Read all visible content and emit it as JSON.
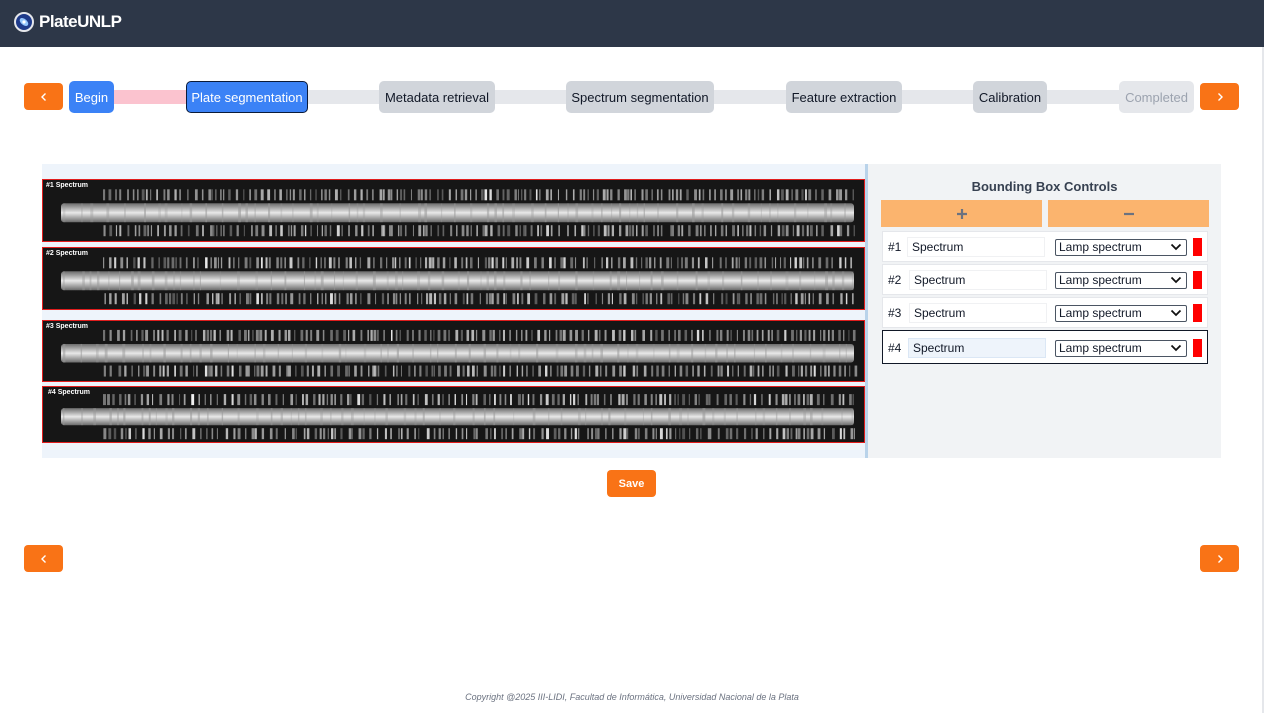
{
  "app": {
    "title": "PlateUNLP",
    "logo_icon": "plate-logo-icon"
  },
  "stepper": {
    "prev_icon": "chevron-left-icon",
    "next_icon": "chevron-right-icon",
    "steps": [
      {
        "label": "Begin",
        "state": "done"
      },
      {
        "label": "Plate segmentation",
        "state": "active"
      },
      {
        "label": "Metadata retrieval",
        "state": "pending"
      },
      {
        "label": "Spectrum segmentation",
        "state": "pending"
      },
      {
        "label": "Feature extraction",
        "state": "pending"
      },
      {
        "label": "Calibration",
        "state": "pending"
      },
      {
        "label": "Completed",
        "state": "disabled"
      }
    ]
  },
  "viewer": {
    "spectra": [
      {
        "label": "#1 Spectrum"
      },
      {
        "label": "#2 Spectrum"
      },
      {
        "label": "#3 Spectrum"
      },
      {
        "label": "#4 Spectrum"
      }
    ],
    "box_color": "#e11d1d"
  },
  "controls": {
    "title": "Bounding Box Controls",
    "add_icon": "plus-icon",
    "remove_icon": "minus-icon",
    "rows": [
      {
        "num": "#1",
        "name": "Spectrum",
        "type": "Lamp spectrum",
        "color": "#ff0000"
      },
      {
        "num": "#2",
        "name": "Spectrum",
        "type": "Lamp spectrum",
        "color": "#ff0000"
      },
      {
        "num": "#3",
        "name": "Spectrum",
        "type": "Lamp spectrum",
        "color": "#ff0000"
      },
      {
        "num": "#4",
        "name": "Spectrum",
        "type": "Lamp spectrum",
        "color": "#ff0000",
        "selected": true
      }
    ]
  },
  "actions": {
    "save_label": "Save"
  },
  "footer": {
    "text": "Copyright @2025 III-LIDI, Facultad de Informática, Universidad Nacional de la Plata"
  },
  "colors": {
    "accent": "#f97316",
    "primary": "#3b82f6",
    "header": "#2d3748"
  }
}
